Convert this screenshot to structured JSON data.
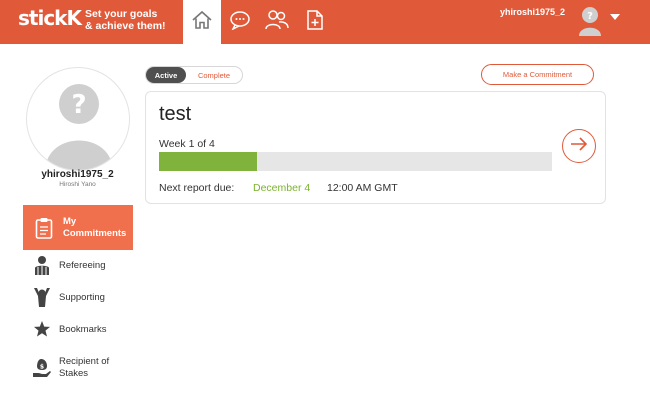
{
  "header": {
    "logo_text": "stickK",
    "tagline_line1": "Set your goals",
    "tagline_line2": "& achieve them!",
    "username": "yhiroshi1975_2",
    "nav_icons": [
      "home-icon",
      "chat-bubble-icon",
      "people-icon",
      "document-add-icon"
    ],
    "brand_color": "#e05a3a"
  },
  "profile": {
    "username": "yhiroshi1975_2",
    "full_name": "Hiroshi Yano"
  },
  "sidebar": {
    "items": [
      {
        "label_line1": "My",
        "label_line2": "Commitments",
        "icon": "clipboard-icon",
        "active": true
      },
      {
        "label": "Refereeing",
        "icon": "referee-icon"
      },
      {
        "label": "Supporting",
        "icon": "cheering-person-icon"
      },
      {
        "label": "Bookmarks",
        "icon": "star-icon"
      },
      {
        "label_line1": "Recipient of",
        "label_line2": "Stakes",
        "icon": "money-hand-icon"
      }
    ]
  },
  "filters": {
    "active_label": "Active",
    "complete_label": "Complete",
    "selected": "Active"
  },
  "actions": {
    "make_commitment_label": "Make a Commitment"
  },
  "commitment": {
    "title": "test",
    "week_text": "Week 1 of 4",
    "progress_fraction": 0.25,
    "report_label": "Next report due:",
    "report_date": "December 4",
    "report_time": "12:00 AM GMT",
    "progress_color": "#80b33c"
  }
}
